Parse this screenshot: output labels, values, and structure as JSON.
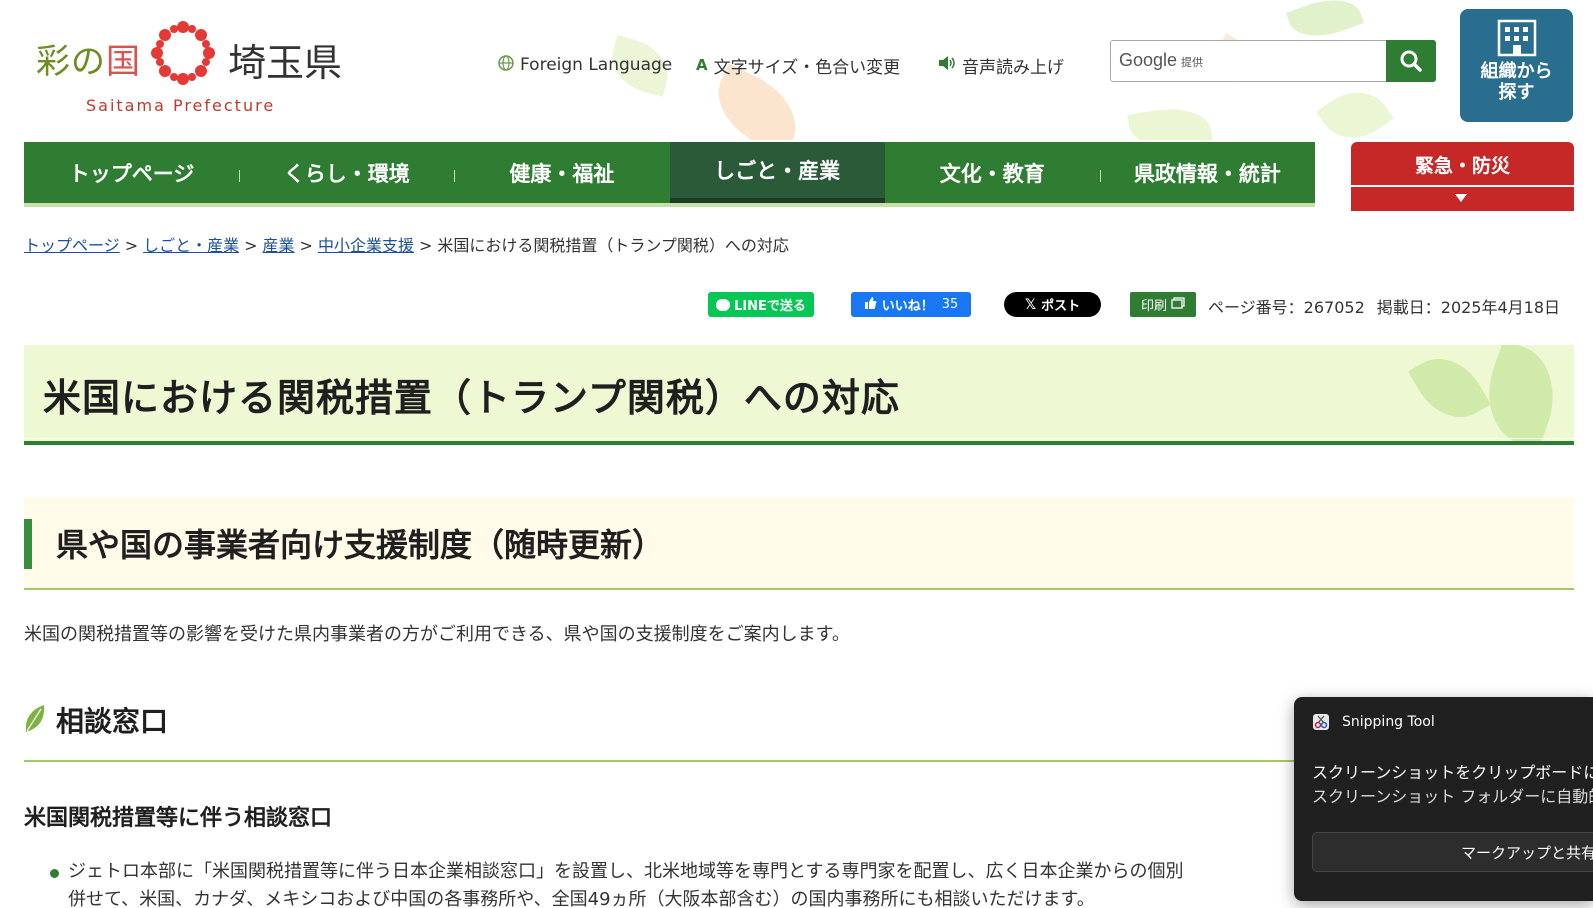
{
  "header": {
    "logo": {
      "sai": "彩の",
      "kuni": "国",
      "ken": "埼玉県",
      "en": "Saitama Prefecture"
    },
    "utility": {
      "foreign": "Foreign Language",
      "font_color": "文字サイズ・色合い変更",
      "voice": "音声読み上げ"
    },
    "search": {
      "provider": "Google",
      "provider_sub": "提供",
      "value": ""
    },
    "org_button": {
      "line1": "組織から",
      "line2": "探す"
    }
  },
  "gnav": {
    "items": [
      "トップページ",
      "くらし・環境",
      "健康・福祉",
      "しごと・産業",
      "文化・教育",
      "県政情報・統計"
    ],
    "active_index": 3
  },
  "emergency": {
    "label": "緊急・防災"
  },
  "breadcrumb": {
    "links": [
      "トップページ",
      "しごと・産業",
      "産業",
      "中小企業支援"
    ],
    "separator": ">",
    "current": "米国における関税措置（トランプ関税）への対応"
  },
  "share": {
    "line": "LINEで送る",
    "fb_label": "いいね！",
    "fb_count": "35",
    "x": "ポスト",
    "print": "印刷"
  },
  "page_meta": {
    "page_number": "ページ番号：267052",
    "published": "掲載日：2025年4月18日"
  },
  "content": {
    "title": "米国における関税措置（トランプ関税）への対応",
    "h2": "県や国の事業者向け支援制度（随時更新）",
    "intro": "米国の関税措置等の影響を受けた県内事業者の方がご利用できる、県や国の支援制度をご案内します。",
    "h3": "相談窓口",
    "h4": "米国関税措置等に伴う相談窓口",
    "bullet_line1": "ジェトロ本部に「米国関税措置等に伴う日本企業相談窓口」を設置し、北米地域等を専門とする専門家を配置し、広く日本企業からの個別",
    "bullet_line2": "併せて、米国、カナダ、メキシコおよび中国の各事務所や、全国49ヵ所（大阪本部含む）の国内事務所にも相談いただけます。"
  },
  "toast": {
    "app": "Snipping Tool",
    "msg1": "スクリーンショットをクリップボードにコピーしました",
    "msg2": "スクリーンショット フォルダーに自動的に保存されました",
    "action": "マークアップと共有"
  },
  "colors": {
    "nav_green": "#2e7d32",
    "nav_active": "#2a5a38",
    "emergency_red": "#c62828",
    "org_blue": "#2a6e8f",
    "title_bg": "#eef8d3",
    "h2_bg": "#fffbe8"
  }
}
